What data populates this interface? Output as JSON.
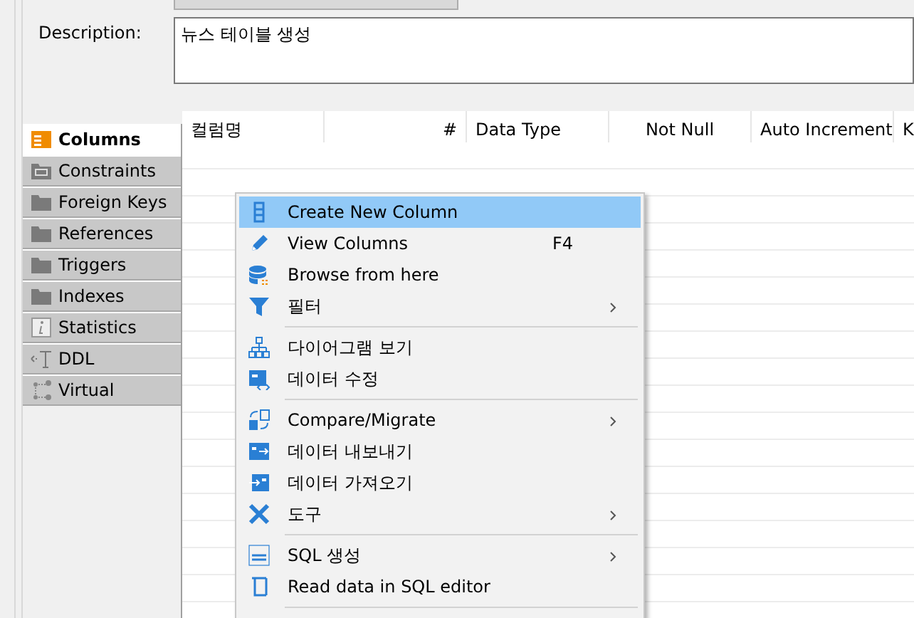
{
  "description": {
    "label": "Description:",
    "value": "뉴스 테이블 생성"
  },
  "tabs": [
    {
      "label": "Columns",
      "selected": true
    },
    {
      "label": "Constraints",
      "selected": false
    },
    {
      "label": "Foreign Keys",
      "selected": false
    },
    {
      "label": "References",
      "selected": false
    },
    {
      "label": "Triggers",
      "selected": false
    },
    {
      "label": "Indexes",
      "selected": false
    },
    {
      "label": "Statistics",
      "selected": false
    },
    {
      "label": "DDL",
      "selected": false
    },
    {
      "label": "Virtual",
      "selected": false
    }
  ],
  "table": {
    "columns": [
      {
        "label": "컬럼명"
      },
      {
        "label": "#"
      },
      {
        "label": "Data Type"
      },
      {
        "label": "Not Null"
      },
      {
        "label": "Auto Increment"
      },
      {
        "label": "K"
      }
    ]
  },
  "context_menu": [
    {
      "kind": "item",
      "label": "Create New Column",
      "selected": true,
      "submenu": false
    },
    {
      "kind": "item",
      "label": "View Columns",
      "shortcut": "F4",
      "selected": false,
      "submenu": false
    },
    {
      "kind": "item",
      "label": "Browse from here",
      "selected": false,
      "submenu": false
    },
    {
      "kind": "item",
      "label": "필터",
      "selected": false,
      "submenu": true
    },
    {
      "kind": "separator"
    },
    {
      "kind": "item",
      "label": "다이어그램 보기",
      "selected": false,
      "submenu": false
    },
    {
      "kind": "item",
      "label": "데이터 수정",
      "selected": false,
      "submenu": false
    },
    {
      "kind": "separator"
    },
    {
      "kind": "item",
      "label": "Compare/Migrate",
      "selected": false,
      "submenu": true
    },
    {
      "kind": "item",
      "label": "데이터 내보내기",
      "selected": false,
      "submenu": false
    },
    {
      "kind": "item",
      "label": "데이터 가져오기",
      "selected": false,
      "submenu": false
    },
    {
      "kind": "item",
      "label": "도구",
      "selected": false,
      "submenu": true
    },
    {
      "kind": "separator"
    },
    {
      "kind": "item",
      "label": "SQL 생성",
      "selected": false,
      "submenu": true
    },
    {
      "kind": "item",
      "label": "Read data in SQL editor",
      "selected": false,
      "submenu": false
    },
    {
      "kind": "separator"
    }
  ]
}
